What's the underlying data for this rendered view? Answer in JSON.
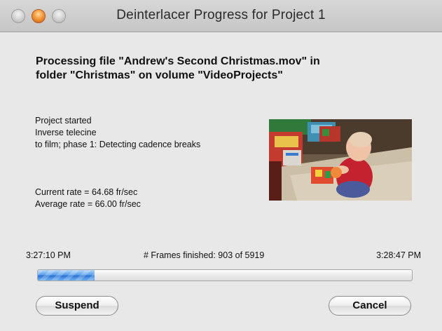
{
  "window": {
    "title": "Deinterlacer Progress for Project 1"
  },
  "heading": "Processing file \"Andrew's Second Christmas.mov\" in\nfolder \"Christmas\" on volume \"VideoProjects\"",
  "status": {
    "lines": [
      "Project started",
      "Inverse telecine",
      "to film; phase 1: Detecting cadence breaks"
    ]
  },
  "rates": {
    "current": "Current rate = 64.68 fr/sec",
    "average": "Average rate = 66.00 fr/sec"
  },
  "progress": {
    "start_time": "3:27:10 PM",
    "frames_text": "# Frames finished: 903 of 5919",
    "end_time": "3:28:47 PM",
    "frames_done": 903,
    "frames_total": 5919
  },
  "buttons": {
    "suspend": "Suspend",
    "cancel": "Cancel"
  },
  "colors": {
    "progress_fill": "#3d86e2",
    "window_bg": "#e8e8e8",
    "minimize_button": "#f59a3a"
  }
}
